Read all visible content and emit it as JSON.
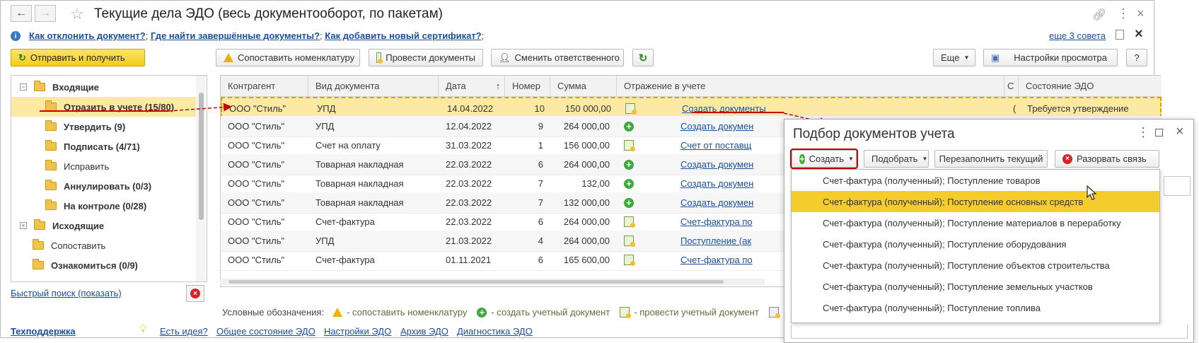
{
  "window": {
    "title": "Текущие дела ЭДО (весь документооборот, по пакетам)"
  },
  "hints": {
    "items": [
      "Как отклонить документ?",
      "Где найти завершённые документы?",
      "Как добавить новый сертификат?"
    ],
    "more": "еще 3 совета"
  },
  "toolbar": {
    "send_receive": "Отправить и получить",
    "match_nomenclature": "Сопоставить номенклатуру",
    "post_documents": "Провести документы",
    "change_responsible": "Сменить ответственного",
    "more": "Еще",
    "view_settings": "Настройки просмотра",
    "help": "?"
  },
  "tree": {
    "items": [
      {
        "label": "Входящие"
      },
      {
        "label": "Отразить в учете (15/80)"
      },
      {
        "label": "Утвердить (9)"
      },
      {
        "label": "Подписать (4/71)"
      },
      {
        "label": "Исправить"
      },
      {
        "label": "Аннулировать (0/3)"
      },
      {
        "label": "На контроле (0/28)"
      },
      {
        "label": "Исходящие"
      },
      {
        "label": "Сопоставить"
      },
      {
        "label": "Ознакомиться (0/9)"
      }
    ],
    "quick_search": "Быстрый поиск (показать)"
  },
  "table": {
    "columns": [
      "Контрагент",
      "Вид документа",
      "Дата",
      "Номер",
      "Сумма",
      "Отражение в учете",
      "С",
      "Состояние ЭДО"
    ],
    "sort_arrow": "↑",
    "rows": [
      {
        "contractor": "ООО \"Стиль\"",
        "doc_type": "УПД",
        "date": "14.04.2022",
        "number": "10",
        "amount": "150 000,00",
        "icon": "post",
        "accounting": "Создать документы",
        "c": "(",
        "state": "Требуется утверждение"
      },
      {
        "contractor": "ООО \"Стиль\"",
        "doc_type": "УПД",
        "date": "12.04.2022",
        "number": "9",
        "amount": "264 000,00",
        "icon": "plus",
        "accounting": "Создать докумен",
        "c": "",
        "state": ""
      },
      {
        "contractor": "ООО \"Стиль\"",
        "doc_type": "Счет на оплату",
        "date": "31.03.2022",
        "number": "1",
        "amount": "156 000,00",
        "icon": "post",
        "accounting": "Счет от поставщ",
        "c": "",
        "state": ""
      },
      {
        "contractor": "ООО \"Стиль\"",
        "doc_type": "Товарная накладная",
        "date": "22.03.2022",
        "number": "6",
        "amount": "264 000,00",
        "icon": "plus",
        "accounting": "Создать докумен",
        "c": "",
        "state": ""
      },
      {
        "contractor": "ООО \"Стиль\"",
        "doc_type": "Товарная накладная",
        "date": "22.03.2022",
        "number": "7",
        "amount": "132,00",
        "icon": "plus",
        "accounting": "Создать докумен",
        "c": "",
        "state": ""
      },
      {
        "contractor": "ООО \"Стиль\"",
        "doc_type": "Товарная накладная",
        "date": "22.03.2022",
        "number": "7",
        "amount": "132 000,00",
        "icon": "plus",
        "accounting": "Создать докумен",
        "c": "",
        "state": ""
      },
      {
        "contractor": "ООО \"Стиль\"",
        "doc_type": "Счет-фактура",
        "date": "22.03.2022",
        "number": "6",
        "amount": "264 000,00",
        "icon": "post",
        "accounting": "Счет-фактура по",
        "c": "",
        "state": ""
      },
      {
        "contractor": "ООО \"Стиль\"",
        "doc_type": "УПД",
        "date": "21.03.2022",
        "number": "4",
        "amount": "264 000,00",
        "icon": "post",
        "accounting": "Поступление (ак",
        "c": "",
        "state": ""
      },
      {
        "contractor": "ООО \"Стиль\"",
        "doc_type": "Счет-фактура",
        "date": "01.11.2021",
        "number": "6",
        "amount": "165 600,00",
        "icon": "post",
        "accounting": "Счет-фактура по",
        "c": "",
        "state": ""
      }
    ]
  },
  "legend": {
    "label": "Условные обозначения:",
    "match": "- сопоставить номенклатуру",
    "create": "- создать учетный документ",
    "post": "- провести учетный документ"
  },
  "footer": {
    "support": "Техподдержка",
    "idea": "Есть идея?",
    "state": "Общее состояние ЭДО",
    "settings": "Настройки ЭДО",
    "archive": "Архив ЭДО",
    "diagnostics": "Диагностика ЭДО"
  },
  "dialog": {
    "title": "Подбор документов учета",
    "create": "Создать",
    "select": "Подобрать",
    "refill": "Перезаполнить текущий",
    "break_link": "Разорвать связь",
    "menu": [
      "Счет-фактура (полученный); Поступление товаров",
      "Счет-фактура (полученный); Поступление основных средств",
      "Счет-фактура (полученный); Поступление материалов в переработку",
      "Счет-фактура (полученный); Поступление оборудования",
      "Счет-фактура (полученный); Поступление объектов строительства",
      "Счет-фактура (полученный); Поступление земельных участков",
      "Счет-фактура (полученный); Поступление топлива"
    ]
  },
  "colors": {
    "accent_yellow": "#f4cd2c",
    "selection": "#fbe9a4",
    "link": "#1a4fa0",
    "annotation_red": "#c40000"
  }
}
